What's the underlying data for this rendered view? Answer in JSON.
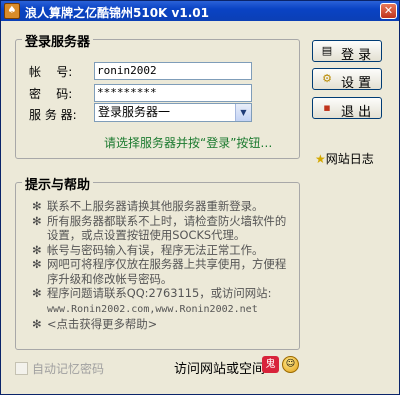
{
  "window": {
    "title": "浪人算牌之亿酷锦州510K v1.01",
    "close_glyph": "✕",
    "app_icon": "poker-app-icon"
  },
  "login": {
    "legend": "登录服务器",
    "account_label": "帐    号:",
    "account_value": "ronin2002",
    "password_label": "密    码:",
    "password_value": "*********",
    "server_label": "服 务 器:",
    "server_value": "登录服务器一",
    "hint": "请选择服务器并按“登录”按钮…"
  },
  "side": {
    "login_label": "登 录",
    "settings_label": "设 置",
    "exit_label": "退 出",
    "login_icon_glyph": "▤",
    "settings_icon_glyph": "⚙",
    "exit_icon_glyph": "▪",
    "news_label": "网站日志",
    "news_icon_glyph": "★"
  },
  "help": {
    "legend": "提示与帮助",
    "bullet": "✻",
    "items": [
      "联系不上服务器请换其他服务器重新登录。",
      "所有服务器都联系不上时，请检查防火墙软件的设置，或点设置按钮使用SOCKS代理。",
      "帐号与密码输入有误，程序无法正常工作。",
      "网吧可将程序仅放在服务器上共享使用，方便程序升级和修改帐号密码。",
      "程序问题请联系QQ:2763115，或访问网站:",
      "<点击获得更多帮助>"
    ],
    "urls": "www.Ronin2002.com,www.Ronin2002.net"
  },
  "footer": {
    "remember_label": "自动记忆密码",
    "visit_label": "访问网站或空间",
    "badge_red_glyph": "鬼",
    "badge_face_glyph": "☺"
  },
  "colors": {
    "title_bar": "#0a43c4",
    "hint": "#1b7a2f",
    "window_bg": "#ece9d8"
  }
}
